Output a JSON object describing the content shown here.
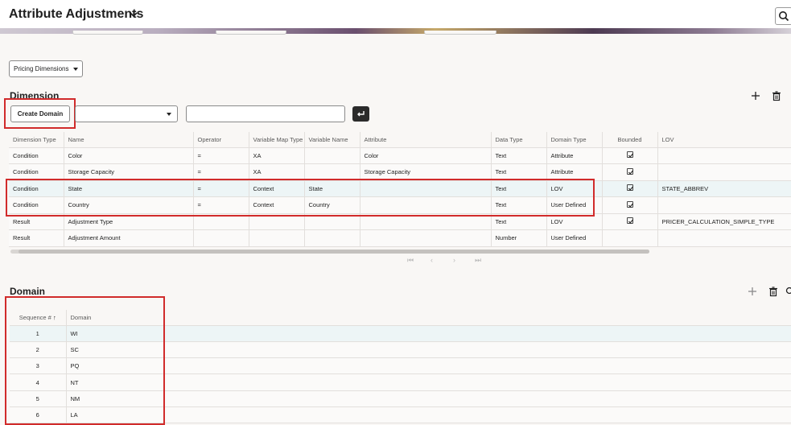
{
  "header": {
    "title": "Attribute Adjustments",
    "chevron_icon": "chevron-down-icon",
    "search_icon": "search-icon"
  },
  "pricing_dimensions": {
    "selected": "Pricing Dimensions"
  },
  "dimension": {
    "title": "Dimension",
    "create_domain_label": "Create Domain",
    "select_value": "",
    "text_value": "",
    "columns": [
      "Dimension Type",
      "Name",
      "Operator",
      "Variable Map Type",
      "Variable Name",
      "Attribute",
      "Data Type",
      "Domain Type",
      "Bounded",
      "LOV"
    ],
    "rows": [
      {
        "type": "Condition",
        "name": "Color",
        "operator": "=",
        "map_type": "XA",
        "var_name": "",
        "attribute": "Color",
        "data_type": "Text",
        "domain_type": "Attribute",
        "bounded": true,
        "lov": ""
      },
      {
        "type": "Condition",
        "name": "Storage Capacity",
        "operator": "=",
        "map_type": "XA",
        "var_name": "",
        "attribute": "Storage Capacity",
        "data_type": "Text",
        "domain_type": "Attribute",
        "bounded": true,
        "lov": ""
      },
      {
        "type": "Condition",
        "name": "State",
        "operator": "=",
        "map_type": "Context",
        "var_name": "State",
        "attribute": "",
        "data_type": "Text",
        "domain_type": "LOV",
        "bounded": true,
        "lov": "STATE_ABBREV"
      },
      {
        "type": "Condition",
        "name": "Country",
        "operator": "=",
        "map_type": "Context",
        "var_name": "Country",
        "attribute": "",
        "data_type": "Text",
        "domain_type": "User Defined",
        "bounded": true,
        "lov": ""
      },
      {
        "type": "Result",
        "name": "Adjustment Type",
        "operator": "",
        "map_type": "",
        "var_name": "",
        "attribute": "",
        "data_type": "Text",
        "domain_type": "LOV",
        "bounded": true,
        "lov": "PRICER_CALCULATION_SIMPLE_TYPE"
      },
      {
        "type": "Result",
        "name": "Adjustment Amount",
        "operator": "",
        "map_type": "",
        "var_name": "",
        "attribute": "",
        "data_type": "Number",
        "domain_type": "User Defined",
        "bounded": false,
        "lov": ""
      }
    ],
    "pager": {
      "first": "⏮",
      "prev": "‹",
      "next": "›",
      "last": "⏭"
    }
  },
  "domain": {
    "title": "Domain",
    "columns": [
      "Sequence #",
      "Domain"
    ],
    "sort_indicator": "↑",
    "rows": [
      {
        "seq": "1",
        "domain": "WI"
      },
      {
        "seq": "2",
        "domain": "SC"
      },
      {
        "seq": "3",
        "domain": "PQ"
      },
      {
        "seq": "4",
        "domain": "NT"
      },
      {
        "seq": "5",
        "domain": "NM"
      },
      {
        "seq": "6",
        "domain": "LA"
      }
    ]
  },
  "colors": {
    "highlight_box": "#d12b2b",
    "selected_row": "#edf5f6",
    "background": "#f9f7f5"
  }
}
